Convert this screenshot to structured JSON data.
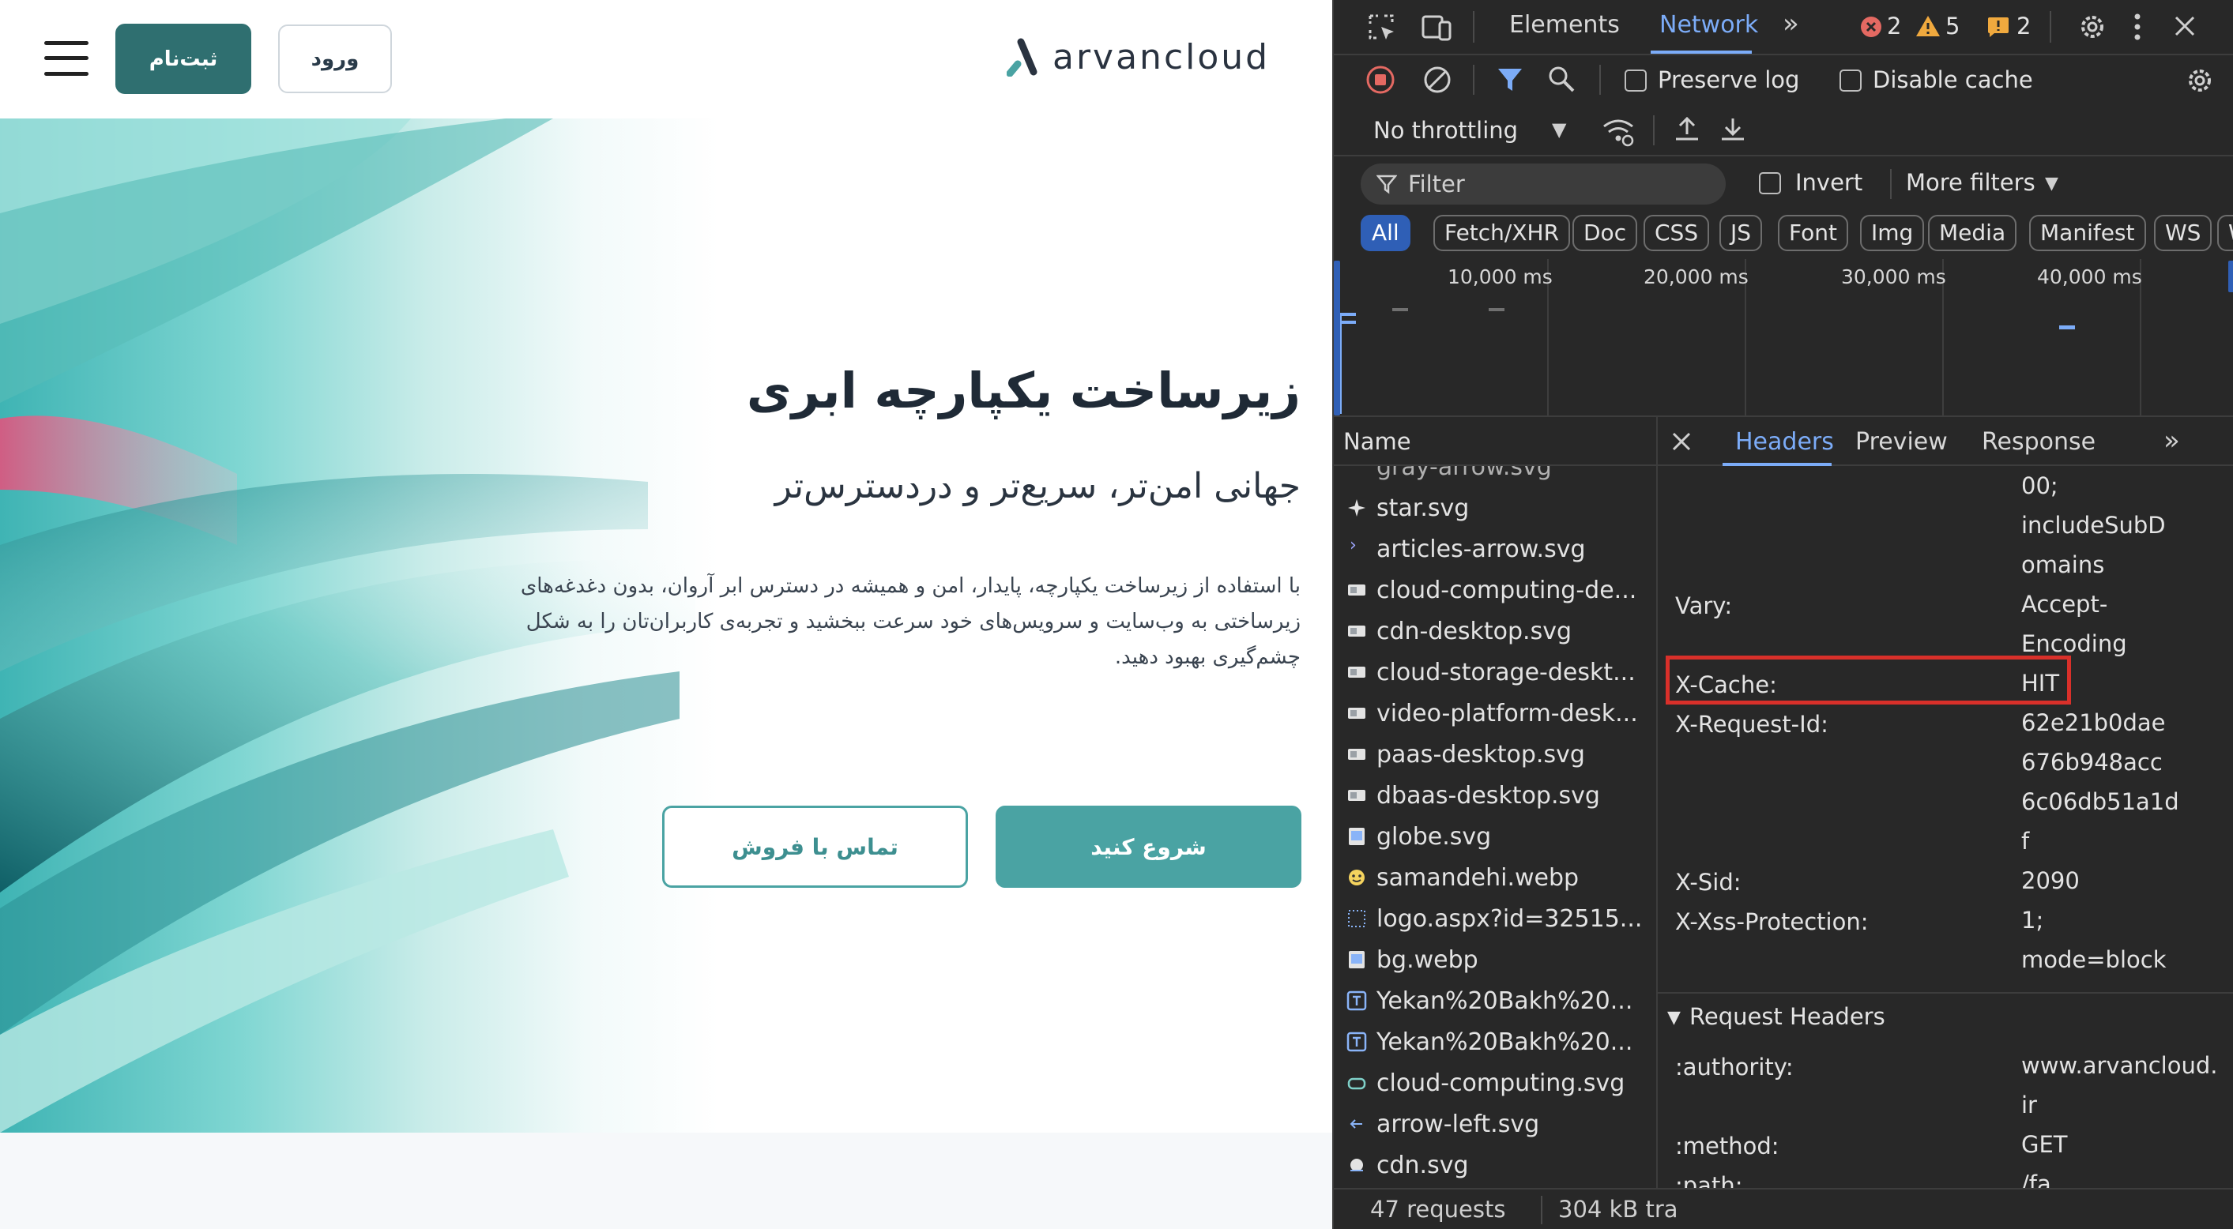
{
  "site": {
    "logo_text": "arvancloud",
    "signup_label": "ثبت‌نام",
    "login_label": "ورود",
    "hero_title": "زیرساخت یکپارچه ابری",
    "hero_subtitle": "جهانی امن‌تر، سریع‌تر و دردسترس‌تر",
    "hero_description": "با استفاده از زیرساخت یکپارچه، پایدار، امن و همیشه در دسترس ابر آروان، بدون دغدغه‌های زیرساختی به وب‌سایت و سرویس‌های خود سرعت ببخشید و تجربه‌ی کاربران‌تان را به شکل چشم‌گیری بهبود دهید.",
    "start_label": "شروع کنید",
    "contact_label": "تماس با فروش",
    "colors": {
      "primary": "#2f6f70",
      "accent": "#4aa3a3"
    }
  },
  "devtools": {
    "tabs": {
      "elements": "Elements",
      "network": "Network"
    },
    "counts": {
      "errors": "2",
      "warnings": "5",
      "issues": "2"
    },
    "toolbar": {
      "preserve_log": "Preserve log",
      "disable_cache": "Disable cache",
      "throttling": "No throttling"
    },
    "filter": {
      "placeholder": "Filter",
      "invert": "Invert",
      "more_filters": "More filters"
    },
    "chips": [
      "All",
      "Fetch/XHR",
      "Doc",
      "CSS",
      "JS",
      "Font",
      "Img",
      "Media",
      "Manifest",
      "WS",
      "W"
    ],
    "timeline_labels": [
      "10,000 ms",
      "20,000 ms",
      "30,000 ms",
      "40,000 ms"
    ],
    "name_header": "Name",
    "files": [
      {
        "name": "gray-arrow.svg",
        "icon": "svg"
      },
      {
        "name": "star.svg",
        "icon": "star"
      },
      {
        "name": "articles-arrow.svg",
        "icon": "chevron"
      },
      {
        "name": "cloud-computing-de...",
        "icon": "image"
      },
      {
        "name": "cdn-desktop.svg",
        "icon": "image"
      },
      {
        "name": "cloud-storage-deskt...",
        "icon": "image"
      },
      {
        "name": "video-platform-desk...",
        "icon": "image"
      },
      {
        "name": "paas-desktop.svg",
        "icon": "image"
      },
      {
        "name": "dbaas-desktop.svg",
        "icon": "image"
      },
      {
        "name": "globe.svg",
        "icon": "image"
      },
      {
        "name": "samandehi.webp",
        "icon": "emoji"
      },
      {
        "name": "logo.aspx?id=32515...",
        "icon": "dots"
      },
      {
        "name": "bg.webp",
        "icon": "image"
      },
      {
        "name": "Yekan%20Bakh%20...",
        "icon": "font"
      },
      {
        "name": "Yekan%20Bakh%20...",
        "icon": "font"
      },
      {
        "name": "cloud-computing.svg",
        "icon": "cloud"
      },
      {
        "name": "arrow-left.svg",
        "icon": "arrow"
      },
      {
        "name": "cdn.svg",
        "icon": "svg"
      }
    ],
    "detail_tabs": {
      "headers": "Headers",
      "preview": "Preview",
      "response": "Response"
    },
    "response_headers": {
      "hsts_tail_1": "00;",
      "hsts_tail_2": "includeSubD",
      "hsts_tail_3": "omains",
      "vary_key": "Vary:",
      "vary_val_1": "Accept-",
      "vary_val_2": "Encoding",
      "xcache_key": "X-Cache:",
      "xcache_val": "HIT",
      "xreq_key": "X-Request-Id:",
      "xreq_val_1": "62e21b0dae",
      "xreq_val_2": "676b948acc",
      "xreq_val_3": "6c06db51a1d",
      "xreq_val_4": "f",
      "xsid_key": "X-Sid:",
      "xsid_val": "2090",
      "xxss_key": "X-Xss-Protection:",
      "xxss_val_1": "1;",
      "xxss_val_2": "mode=block"
    },
    "request_headers": {
      "title": "Request Headers",
      "authority_key": ":authority:",
      "authority_val_1": "www.arvancloud.",
      "authority_val_2": "ir",
      "method_key": ":method:",
      "method_val": "GET",
      "path_key": ":path:",
      "path_val": "/fa"
    },
    "status": {
      "requests": "47 requests",
      "transferred": "304 kB tra"
    },
    "colors": {
      "accent": "#7cacf8",
      "highlight": "#d9302a",
      "error": "#e46962",
      "warning": "#f0a93e"
    }
  }
}
